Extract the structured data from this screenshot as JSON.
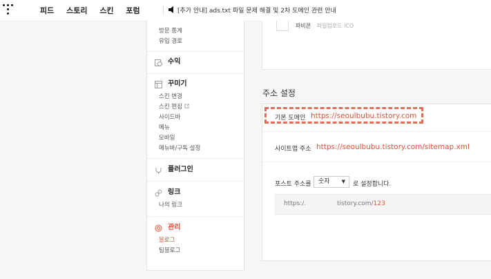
{
  "header": {
    "nav": [
      "피드",
      "스토리",
      "스킨",
      "포럼"
    ],
    "notice": "[추가 안내] ads.txt 파일 문제 해결 및 2차 도메인 관련 안내"
  },
  "sidebar": {
    "stats_items": [
      "방문 통계",
      "유입 경로"
    ],
    "revenue": "수익",
    "decorate": {
      "title": "꾸미기",
      "items": [
        "스킨 변경",
        "스킨 편집",
        "사이드바",
        "메뉴",
        "모바일",
        "메뉴바/구독 설정"
      ]
    },
    "plugin": "플러그인",
    "link": {
      "title": "링크",
      "items": [
        "나의 링크"
      ]
    },
    "manage": {
      "title": "관리",
      "items": [
        "블로그",
        "팀블로그"
      ]
    }
  },
  "top_card": {
    "label": "파비콘",
    "faint": "파일업로드 ICO"
  },
  "address": {
    "section_title": "주소 설정",
    "default_domain_label": "기본 도메인",
    "default_domain_value": "https://seoulbubu.tistory.com",
    "sitemap_label": "사이트맵 주소",
    "sitemap_value": "https://seoulbubu.tistory.com/sitemap.xml",
    "post_address_prefix": "포스트 주소를",
    "post_address_select": "숫자",
    "post_address_suffix": "로 설정합니다.",
    "example_prefix": "https:/.",
    "example_mid": "tistory.com/",
    "example_num": "123"
  },
  "colors": {
    "accent": "#f04b2f",
    "link": "#e2513b",
    "highlight_dash": "#e06b5a"
  }
}
